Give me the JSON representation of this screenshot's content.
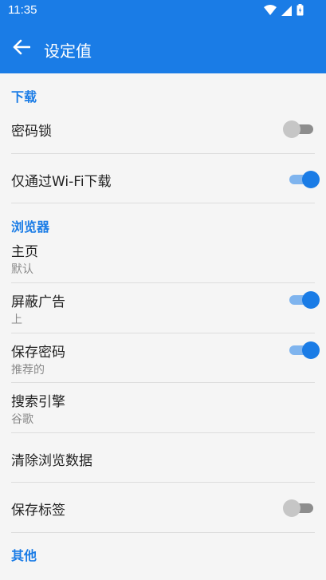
{
  "status_bar": {
    "time": "11:35",
    "icons": [
      "wifi-icon",
      "signal-icon",
      "battery-icon"
    ]
  },
  "app_bar": {
    "back_icon": "arrow-left-icon",
    "title": "设定值"
  },
  "colors": {
    "accent": "#1a7ce6",
    "toggle_on_track": "#7fb4ee",
    "toggle_off_thumb": "#c6c6c6",
    "toggle_off_track": "#8d8d8d",
    "background": "#f5f5f5"
  },
  "sections": {
    "download": {
      "header": "下载",
      "items": [
        {
          "title": "密码锁",
          "toggle": false
        },
        {
          "title": "仅通过Wi-Fi下载",
          "toggle": true
        }
      ]
    },
    "browser": {
      "header": "浏览器",
      "items": [
        {
          "title": "主页",
          "subtitle": "默认"
        },
        {
          "title": "屏蔽广告",
          "subtitle": "上",
          "toggle": true
        },
        {
          "title": "保存密码",
          "subtitle": "推荐的",
          "toggle": true
        },
        {
          "title": "搜索引擎",
          "subtitle": "谷歌"
        },
        {
          "title": "清除浏览数据"
        },
        {
          "title": "保存标签",
          "toggle": false
        }
      ]
    },
    "other": {
      "header": "其他"
    }
  }
}
